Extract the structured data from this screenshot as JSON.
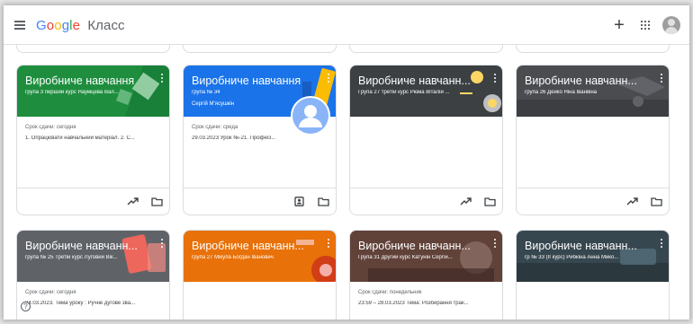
{
  "app": {
    "brand_letters": [
      "G",
      "o",
      "o",
      "g",
      "l",
      "e"
    ],
    "product_name": "Класс"
  },
  "header": {
    "add_label": "+"
  },
  "cards": [
    {
      "title": "Виробниче навчання",
      "section": "група 3 перший курс Наумцева Вал...",
      "teacher": "",
      "color": "#1e8e3e",
      "due_label": "Срок сдачи: сегодня",
      "due_text": "1. Опрацювати навчальний матеріал. 2. С..."
    },
    {
      "title": "Виробниче навчання",
      "section": "група № 34",
      "teacher": "Сергій М'ясушкін",
      "color": "#1a73e8",
      "due_label": "Срок сдачи: среда",
      "due_text": "29.03.2023 Урок №-21. Професі..."
    },
    {
      "title": "Виробниче навчанн...",
      "section": "Група 27 третій курс Рюма Віталій ...",
      "teacher": "",
      "color": "#3c4043",
      "due_label": "",
      "due_text": ""
    },
    {
      "title": "Виробниче навчанн...",
      "section": "група 26 Дейко Ніна Іванівна",
      "teacher": "",
      "color": "#4a4c50",
      "due_label": "",
      "due_text": ""
    },
    {
      "title": "Виробниче навчанн...",
      "section": "група № 25 Третій курс Луговий Вік...",
      "teacher": "",
      "color": "#5f6368",
      "due_label": "Срок сдачи: сегодня",
      "due_text": "24.03.2023. Тема уроку : Ручне дугове зва..."
    },
    {
      "title": "Виробниче навчанн...",
      "section": "група 27 Мікула Богдан Іванович",
      "teacher": "",
      "color": "#e8710a",
      "due_label": "",
      "due_text": ""
    },
    {
      "title": "Виробниче навчанн...",
      "section": "Група 31 другий курс Катунін Сергій...",
      "teacher": "",
      "color": "#6d4c41",
      "due_label": "Срок сдачи: понедельник",
      "due_text": "23:59 – 28.03.2023 Тема: Розбирання трак..."
    },
    {
      "title": "Виробниче навчанн...",
      "section": "гр № 33 (ІІ курс) Рибкіна Анна Мико...",
      "teacher": "",
      "color": "#37474f",
      "due_label": "",
      "due_text": ""
    }
  ],
  "help": {
    "label": "?"
  }
}
